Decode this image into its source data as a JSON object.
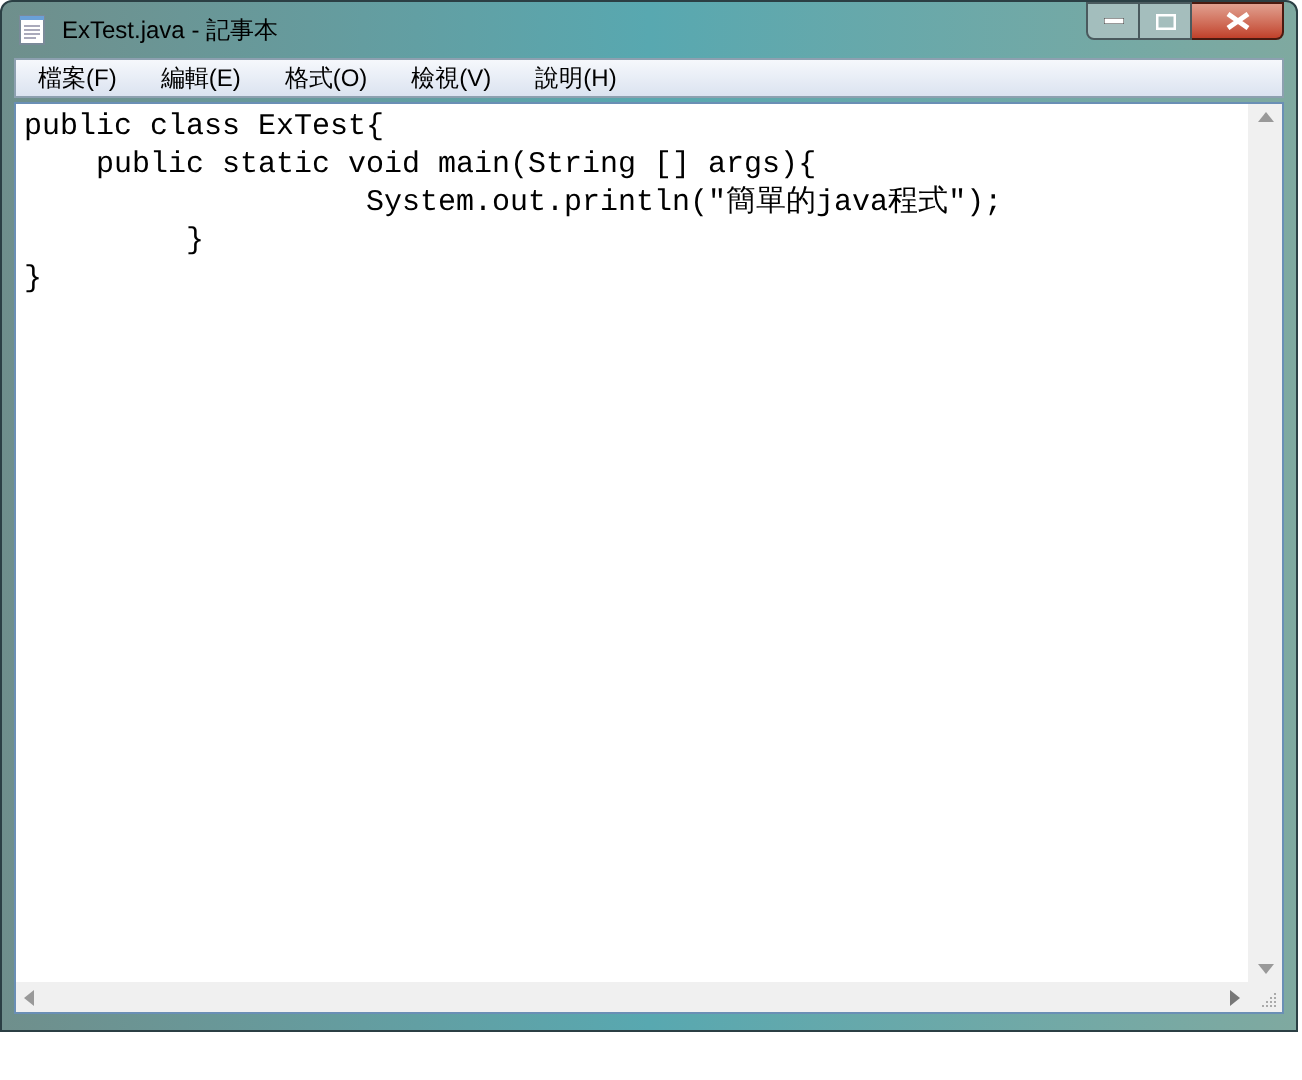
{
  "window": {
    "title": "ExTest.java - 記事本"
  },
  "menu": [
    {
      "label": "檔案(F)",
      "selected": false
    },
    {
      "label": "編輯(E)",
      "selected": false
    },
    {
      "label": "格式(O)",
      "selected": false
    },
    {
      "label": "檢視(V)",
      "selected": false
    },
    {
      "label": "說明(H)",
      "selected": false
    }
  ],
  "editor": {
    "lines": [
      "public class ExTest{",
      "    public static void main(String [] args){",
      "                   System.out.println(\"簡單的java程式\");",
      "         }",
      "}"
    ]
  }
}
